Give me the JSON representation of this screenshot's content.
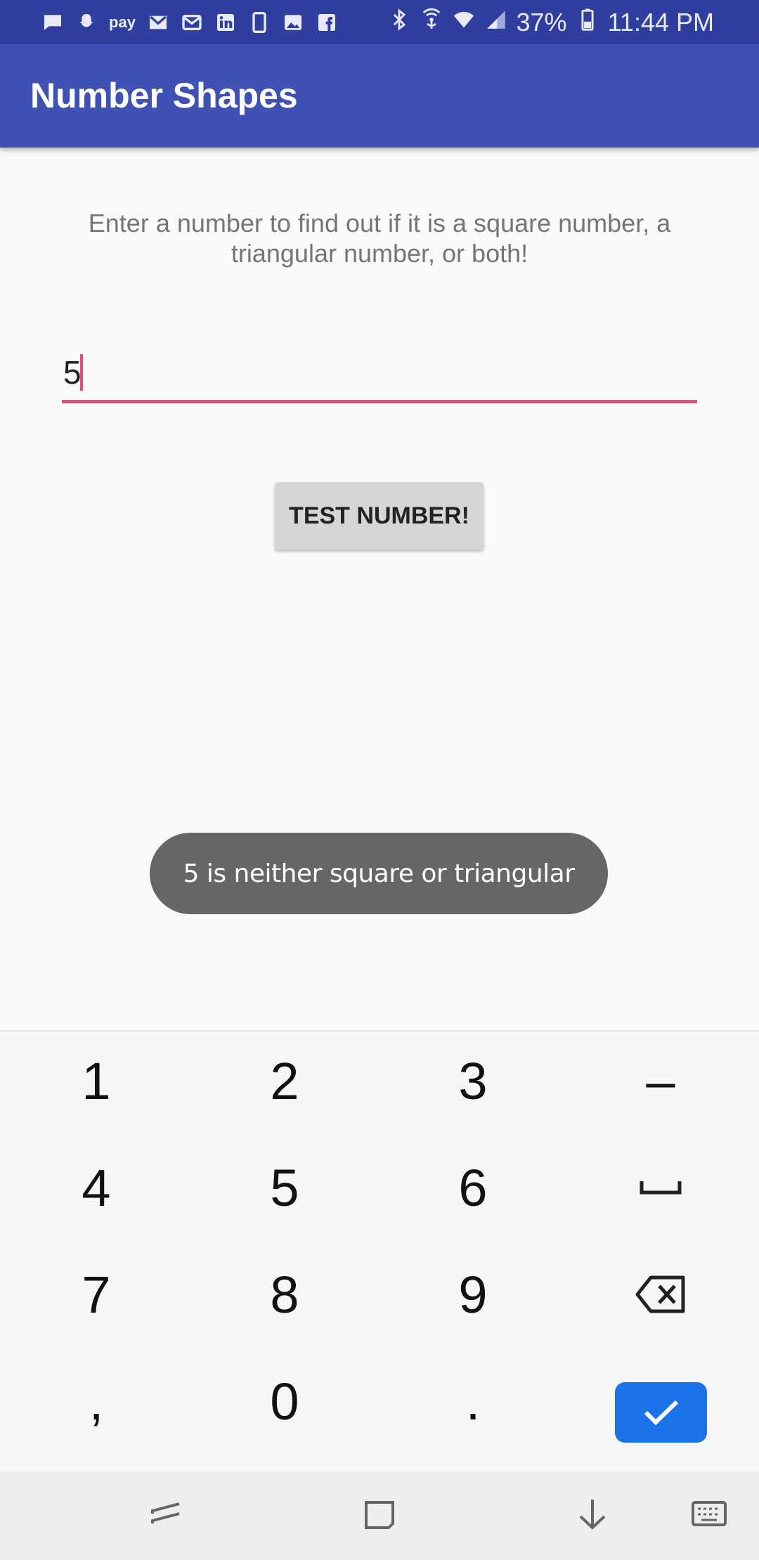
{
  "status_bar": {
    "notification_icons": [
      "message-icon",
      "snapchat-icon",
      "samsung-pay-icon",
      "gmail-icon",
      "email-icon",
      "linkedin-icon",
      "phone-icon",
      "image-icon",
      "facebook-icon"
    ],
    "samsung_pay_label": "pay",
    "battery": "37%",
    "time": "11:44 PM"
  },
  "app_bar": {
    "title": "Number Shapes"
  },
  "main": {
    "instruction": "Enter a number to find out if it is a square number, a triangular number, or both!",
    "number_input": {
      "value": "5"
    },
    "test_button_label": "TEST NUMBER!"
  },
  "toast": {
    "message": "5 is neither square or triangular"
  },
  "keyboard": {
    "rows": [
      [
        "1",
        "2",
        "3",
        "–"
      ],
      [
        "4",
        "5",
        "6",
        "space-icon"
      ],
      [
        "7",
        "8",
        "9",
        "backspace-icon"
      ],
      [
        ",",
        "0",
        ".",
        "done-check-icon"
      ]
    ],
    "done_color": "#1a73e8"
  },
  "nav_bar": {
    "icons": [
      "recents-icon",
      "home-icon",
      "back-icon",
      "keyboard-hide-icon"
    ]
  },
  "colors": {
    "status_bar": "#303f9f",
    "app_bar": "#3f51b5",
    "accent": "#e84b7a",
    "toast": "#666666"
  }
}
